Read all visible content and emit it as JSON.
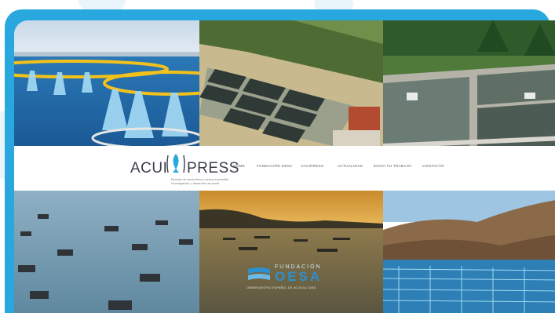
{
  "site": {
    "logo_left": "ACUI",
    "logo_right": "PRESS",
    "tagline_line1": "Revista de acuicultura y pesca sostenible",
    "tagline_line2": "Investigación y desarrollo acuícola"
  },
  "nav": {
    "items": [
      {
        "label": "HOME"
      },
      {
        "label": "FUNDACIÓN OESA"
      },
      {
        "label": "ACUIPRESS"
      },
      {
        "label": "ACTUALIDAD"
      },
      {
        "label": "ENVÍA TU TRABAJO"
      },
      {
        "label": "CONTACTO"
      }
    ]
  },
  "oesa_logo": {
    "line1": "FUNDACIÓN",
    "line2": "OESA",
    "line3": "OBSERVATORIO ESPAÑOL DE ACUICULTURA"
  },
  "colors": {
    "frame": "#29a8e0",
    "logo_text": "#3a3f4a",
    "logo_fish": "#29a8e0",
    "oesa_blue": "#2e8fcf"
  },
  "icons": [
    "fish-icon"
  ]
}
